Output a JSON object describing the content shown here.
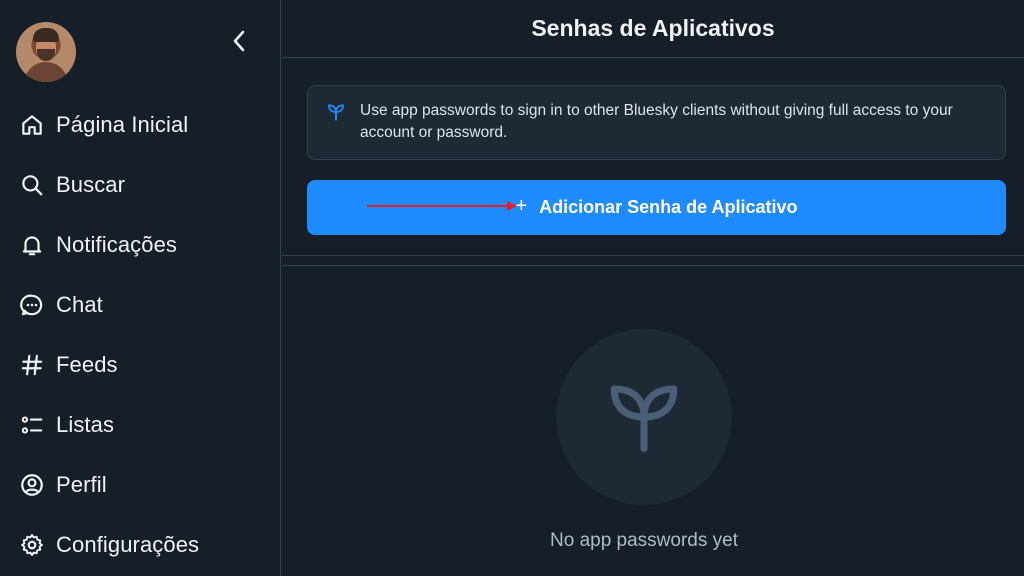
{
  "header": {
    "title": "Senhas de Aplicativos"
  },
  "sidebar": {
    "collapse_icon": "chevron-left-icon",
    "items": [
      {
        "label": "Página Inicial",
        "icon": "home-icon"
      },
      {
        "label": "Buscar",
        "icon": "search-icon"
      },
      {
        "label": "Notificações",
        "icon": "bell-icon"
      },
      {
        "label": "Chat",
        "icon": "chat-bubble-icon"
      },
      {
        "label": "Feeds",
        "icon": "hash-icon"
      },
      {
        "label": "Listas",
        "icon": "list-icon"
      },
      {
        "label": "Perfil",
        "icon": "user-circle-icon"
      },
      {
        "label": "Configurações",
        "icon": "gear-icon"
      }
    ]
  },
  "info": {
    "icon": "sprout-icon",
    "text": "Use app passwords to sign in to other Bluesky clients without giving full access to your account or password."
  },
  "add_button": {
    "plus": "+",
    "label": "Adicionar Senha de Aplicativo"
  },
  "empty_state": {
    "icon": "sprout-icon",
    "text": "No app passwords yet"
  },
  "colors": {
    "background": "#161e27",
    "border": "#2e4052",
    "accent": "#208bfe",
    "annotation_arrow": "#e0202a",
    "muted_text": "#aebbc9"
  }
}
